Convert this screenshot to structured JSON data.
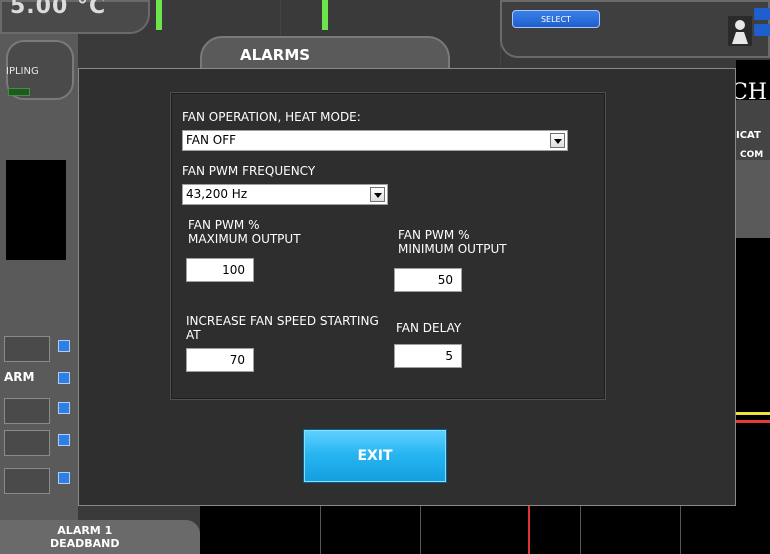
{
  "background": {
    "temperature_text": "5.00 °C",
    "select_label": "SELECT",
    "alarms_tab_label": "ALARMS",
    "sampling_label": "IPLING",
    "alarm_row_label": "ARM",
    "alarm1_deadband_line1": "ALARM 1",
    "alarm1_deadband_line2": "DEADBAND",
    "brand_partial": "CH",
    "icat_partial": "ICAT",
    "com_partial": "COM"
  },
  "dialog": {
    "fan_operation": {
      "label": "FAN OPERATION, HEAT MODE:",
      "value": "FAN OFF"
    },
    "fan_pwm_frequency": {
      "label": "FAN PWM FREQUENCY",
      "value": "43,200 Hz"
    },
    "fan_pwm_max": {
      "label_line1": "FAN PWM %",
      "label_line2": "MAXIMUM OUTPUT",
      "value": "100"
    },
    "fan_pwm_min": {
      "label_line1": "FAN PWM %",
      "label_line2": "MINIMUM OUTPUT",
      "value": "50"
    },
    "increase_fan_speed": {
      "label_line1": "INCREASE FAN SPEED STARTING",
      "label_line2": "AT",
      "value": "70"
    },
    "fan_delay": {
      "label": "FAN DELAY",
      "value": "5"
    },
    "exit_label": "EXIT"
  },
  "colors": {
    "dialog_bg": "#2f2f2f",
    "exit_button": "#28b6f2",
    "accent_green": "#6de44c",
    "accent_blue": "#1f5fcd"
  }
}
